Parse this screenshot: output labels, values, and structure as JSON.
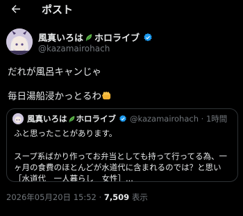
{
  "header": {
    "title": "ポスト",
    "back_icon": "arrow-left-icon"
  },
  "author": {
    "name": "風真いろは",
    "name_suffix": "ホロライブ",
    "handle": "@kazamairohach",
    "verified_color": "#1d9bf0"
  },
  "tweet": {
    "line1": "だれが風呂キャンじゃ",
    "line2": "毎日湯船浸かっとるわ",
    "emoji_icon": "fist-icon"
  },
  "quote": {
    "name": "風真いろは",
    "name_suffix": "ホロライブ",
    "handle": "@kazamairohach",
    "time": "1時間",
    "line1": "ふと思ったことがあります。",
    "line2": "スープ系ばかり作ってお弁当としても持って行ってる為、一",
    "line3": "ヶ月の食費のほとんどが水道代に含まれるのでは？と思い",
    "line4": "［水道代　一人暮らし　女性］..."
  },
  "meta": {
    "timestamp": "2026年05月20日 15:52",
    "separator": "·",
    "views": "7,509",
    "views_label": "表示"
  }
}
